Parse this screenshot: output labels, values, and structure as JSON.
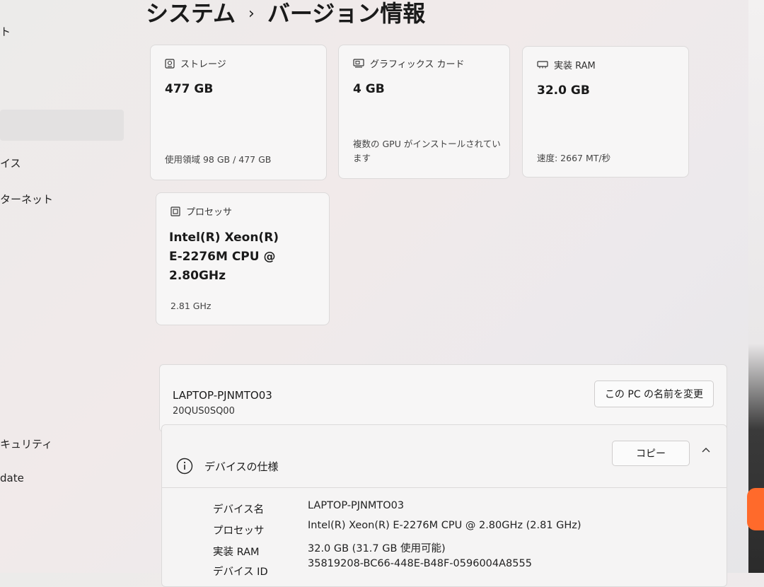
{
  "sidebar": {
    "items": [
      {
        "label": "ト"
      },
      {
        "label": "イス"
      },
      {
        "label": "ターネット"
      },
      {
        "label": "キュリティ"
      },
      {
        "label": "date"
      }
    ]
  },
  "breadcrumb": {
    "parent": "システム",
    "separator": "›",
    "current": "バージョン情報"
  },
  "cards": {
    "storage": {
      "title": "ストレージ",
      "value": "477 GB",
      "sub": "使用領域 98 GB / 477 GB"
    },
    "gpu": {
      "title": "グラフィックス カード",
      "value": "4 GB",
      "sub_line1": "複数の GPU がインストールされてい",
      "sub_line2": "ます"
    },
    "ram": {
      "title": "実装 RAM",
      "value": "32.0 GB",
      "sub": "速度: 2667 MT/秒"
    },
    "processor": {
      "title": "プロセッサ",
      "value_line1": "Intel(R) Xeon(R)",
      "value_line2": "E-2276M  CPU @",
      "value_line3": "2.80GHz",
      "sub": "2.81 GHz"
    }
  },
  "pc": {
    "name": "LAPTOP-PJNMTO03",
    "model": "20QUS0SQ00",
    "rename_label": "この PC の名前を変更"
  },
  "device_spec": {
    "title": "デバイスの仕様",
    "copy_label": "コピー",
    "rows": [
      {
        "label": "デバイス名",
        "value": "LAPTOP-PJNMTO03"
      },
      {
        "label": "プロセッサ",
        "value": "Intel(R) Xeon(R) E-2276M  CPU @ 2.80GHz (2.81 GHz)"
      },
      {
        "label": "実装 RAM",
        "value": "32.0 GB (31.7 GB 使用可能)"
      },
      {
        "label": "デバイス ID",
        "value": "35819208-BC66-448E-B48F-0596004A8555"
      }
    ]
  }
}
